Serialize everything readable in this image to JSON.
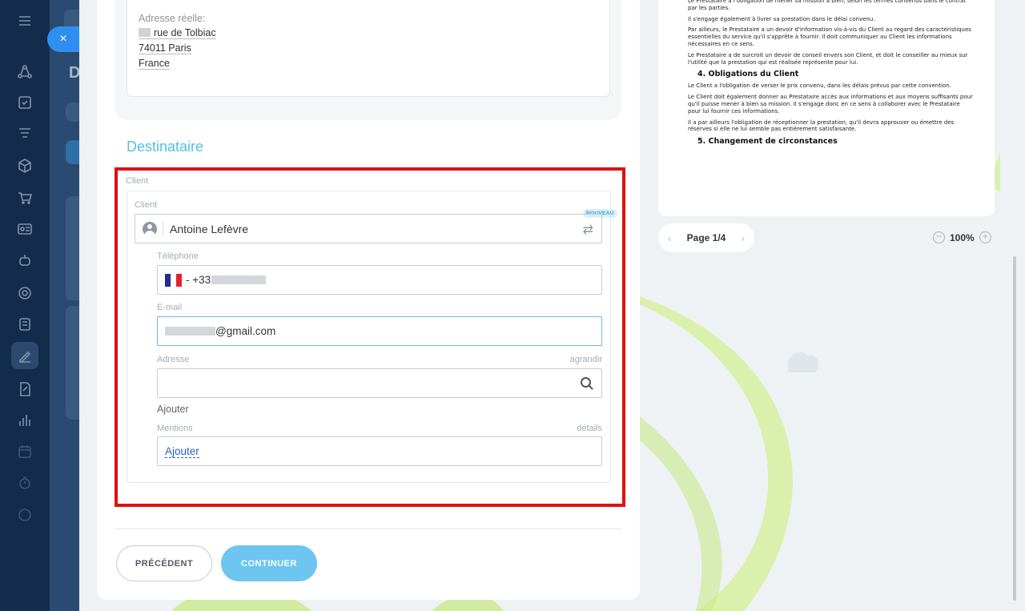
{
  "app": {
    "close_label": "×",
    "back_title_letter": "D"
  },
  "sidebar": {
    "icons": [
      "menu-icon",
      "crm-icon",
      "tasks-icon",
      "filter-icon",
      "box-icon",
      "cart-icon",
      "id-card-icon",
      "robot-icon",
      "target-icon",
      "building-icon",
      "sign-icon",
      "doc-sign-icon",
      "analytics-icon",
      "calendar-icon",
      "timer-icon",
      "more-icon"
    ]
  },
  "address_card": {
    "label": "Adresse réelle:",
    "street": "rue de Tolbiac",
    "city": "74011 Paris",
    "country": "France"
  },
  "recipient": {
    "section_title": "Destinataire",
    "outer_label": "Client",
    "client_label": "Client",
    "client_name": "Antoine Lefèvre",
    "new_badge": "NOUVEAU",
    "phone_label": "Téléphone",
    "phone_prefix": "- +33",
    "email_label": "E-mail",
    "email_suffix": "@gmail.com",
    "address_label": "Adresse",
    "address_expand": "agrandir",
    "address_value": "",
    "add_label": "Ajouter",
    "mentions_label": "Mentions",
    "mentions_details": "détails",
    "mentions_add": "Ajouter"
  },
  "footer": {
    "prev_label": "PRÉCÉDENT",
    "next_label": "CONTINUER"
  },
  "preview": {
    "paragraphs_top": [
      "Le Prestataire a l'obligation de mener sa mission à bien, selon les termes convenus dans le contrat par les parties.",
      "Il s'engage également à livrer sa prestation dans le délai convenu.",
      "Par ailleurs, le Prestataire a un devoir d'information vis-à-vis du Client au regard des caractéristiques essentielles du service qu'il s'apprête à fournir. Il doit communiquer au Client les informations nécessaires en ce sens.",
      "Le Prestataire a de surcroit un devoir de conseil envers son Client, et doit le conseiller au mieux sur l'utilité que la prestation qui est réalisée représente pour lui."
    ],
    "heading_4": "4. Obligations du Client",
    "paragraphs_client": [
      "Le Client a l'obligation de verser le prix convenu, dans les délais prévus par cette convention.",
      "Le Client doit également donner au Prestataire accès aux informations et aux moyens suffisants pour qu'il puisse mener à bien sa mission. Il s'engage donc en ce sens à collaborer avec le Prestataire pour lui fournir ces informations.",
      "Il a par ailleurs l'obligation de réceptionner la prestation, qu'il devra approuver ou émettre des réserves si elle ne lui semble pas entièrement satisfaisante."
    ],
    "heading_5": "5. Changement de circonstances",
    "page_label": "Page 1/4",
    "page_prev": "‹",
    "page_next": "›",
    "zoom_level": "100%",
    "zoom_out": "−",
    "zoom_in": "+"
  },
  "colors": {
    "accent": "#53c0e8",
    "highlight_frame": "#e01010",
    "continue_button": "#6cc6f0",
    "link": "#2566c0"
  }
}
